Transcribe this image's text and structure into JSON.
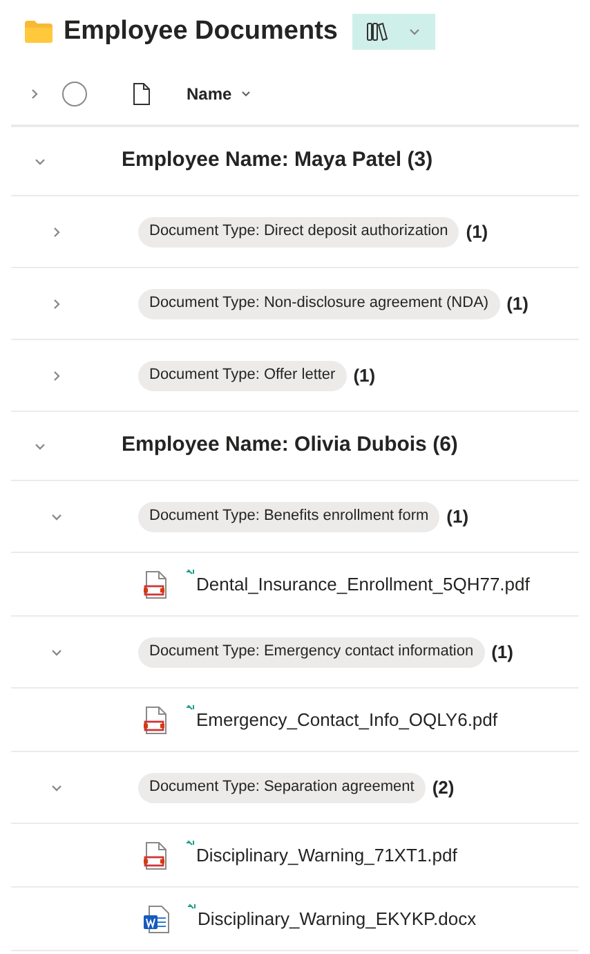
{
  "title": "Employee Documents",
  "select_all": {
    "checked": false
  },
  "column_header": {
    "label": "Name"
  },
  "groups": [
    {
      "label": "Employee Name: Maya Patel",
      "count": "(3)",
      "expanded": true,
      "children": [
        {
          "label": "Document Type: Direct deposit authorization",
          "count": "(1)",
          "expanded": false
        },
        {
          "label": "Document Type: Non-disclosure agreement (NDA)",
          "count": "(1)",
          "expanded": false
        },
        {
          "label": "Document Type: Offer letter",
          "count": "(1)",
          "expanded": false
        }
      ]
    },
    {
      "label": "Employee Name: Olivia Dubois",
      "count": "(6)",
      "expanded": true,
      "children": [
        {
          "label": "Document Type: Benefits enrollment form",
          "count": "(1)",
          "expanded": true,
          "files": [
            {
              "name": "Dental_Insurance_Enrollment_5QH77.pdf",
              "kind": "pdf"
            }
          ]
        },
        {
          "label": "Document Type: Emergency contact information",
          "count": "(1)",
          "expanded": true,
          "files": [
            {
              "name": "Emergency_Contact_Info_OQLY6.pdf",
              "kind": "pdf"
            }
          ]
        },
        {
          "label": "Document Type: Separation agreement",
          "count": "(2)",
          "expanded": true,
          "files": [
            {
              "name": "Disciplinary_Warning_71XT1.pdf",
              "kind": "pdf"
            },
            {
              "name": "Disciplinary_Warning_EKYKP.docx",
              "kind": "docx"
            }
          ]
        }
      ]
    }
  ]
}
